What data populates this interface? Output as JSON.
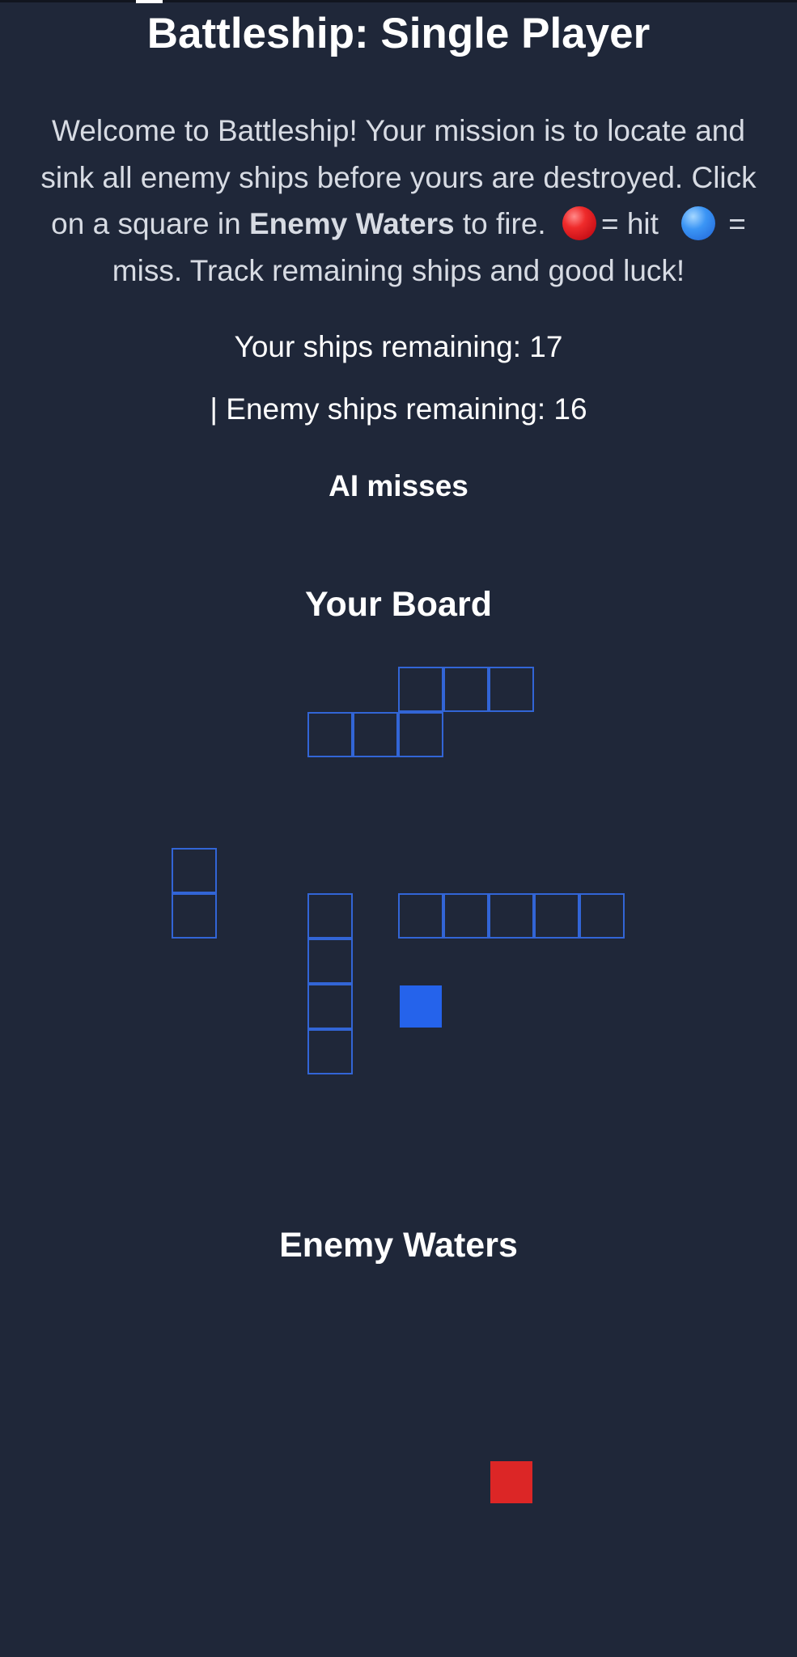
{
  "title": "Battleship: Single Player",
  "intro": {
    "part1": "Welcome to Battleship! Your mission is to locate and sink all enemy ships before yours are destroyed. Click on a square in ",
    "bold": "Enemy Waters",
    "part2": " to fire. ",
    "hit_label": "= hit",
    "part3": " = miss. Track remaining ships and good luck!"
  },
  "status": {
    "your_ships": "Your ships remaining: 17",
    "enemy_ships": "| Enemy ships remaining: 16"
  },
  "ai_message": "AI misses",
  "your_board": {
    "heading": "Your Board",
    "ship_cells": [
      [
        0,
        5
      ],
      [
        0,
        6
      ],
      [
        0,
        7
      ],
      [
        1,
        3
      ],
      [
        1,
        4
      ],
      [
        1,
        5
      ],
      [
        4,
        0
      ],
      [
        5,
        0
      ],
      [
        5,
        3
      ],
      [
        6,
        3
      ],
      [
        7,
        3
      ],
      [
        8,
        3
      ],
      [
        5,
        5
      ],
      [
        5,
        6
      ],
      [
        5,
        7
      ],
      [
        5,
        8
      ],
      [
        5,
        9
      ]
    ],
    "miss_cells": [
      [
        7,
        5
      ]
    ]
  },
  "enemy_board": {
    "heading": "Enemy Waters",
    "hit_cells": [
      [
        4,
        7
      ]
    ]
  },
  "colors": {
    "background": "#1f2739",
    "ship_outline": "#3265d6",
    "miss": "#2563eb",
    "hit": "#dc2626"
  }
}
